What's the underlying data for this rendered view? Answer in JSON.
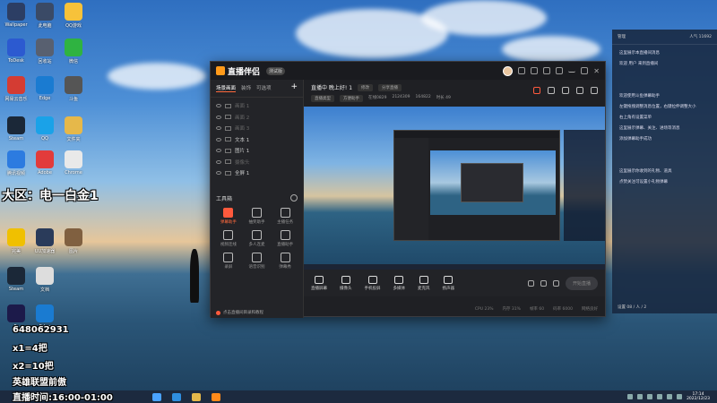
{
  "desktop": {
    "icons": [
      {
        "label": "Wallpaper",
        "color": "#2c3e64"
      },
      {
        "label": "此电脑",
        "color": "#3a4a66"
      },
      {
        "label": "QQ游戏",
        "color": "#f7c23a"
      },
      {
        "label": "ToDesk",
        "color": "#2c5ad0"
      },
      {
        "label": "回收站",
        "color": "#586070"
      },
      {
        "label": "微信",
        "color": "#2fb341"
      },
      {
        "label": "网易云音乐",
        "color": "#d43c33"
      },
      {
        "label": "Edge",
        "color": "#1a7bd1"
      },
      {
        "label": "斗鱼",
        "color": "#555"
      },
      {
        "label": "Steam",
        "color": "#1b2838"
      },
      {
        "label": "QQ",
        "color": "#1aa2e8"
      },
      {
        "label": "文件夹",
        "color": "#e6b84a"
      },
      {
        "label": "腾讯视频",
        "color": "#2c7be0"
      },
      {
        "label": "Adobe",
        "color": "#e23b3b"
      },
      {
        "label": "Chrome",
        "color": "#e9e9e9"
      },
      {
        "label": "完美",
        "color": "#f0c000"
      },
      {
        "label": "UU加速器",
        "color": "#2a3b5a"
      },
      {
        "label": "图片",
        "color": "#806040"
      },
      {
        "label": "Steam",
        "color": "#1b2838"
      },
      {
        "label": "文档",
        "color": "#dddddd"
      },
      {
        "label": "Pr",
        "color": "#1c1a4a"
      },
      {
        "label": "Edge",
        "color": "#1a7bd1"
      }
    ],
    "overlay": {
      "region": "大区：电一白金1",
      "qq": "648062931",
      "rule1": "x1=4把",
      "rule2": "x2=10把",
      "game": "英雄联盟前傲",
      "live_time": "直播时间:16:00-01:00"
    }
  },
  "app": {
    "name": "直播伴侣",
    "version": "测试版",
    "left_tabs": [
      "场景画面",
      "装饰",
      "可选项"
    ],
    "scenes": [
      {
        "label": "画面 1",
        "on": false
      },
      {
        "label": "画面 2",
        "on": false
      },
      {
        "label": "画面 3",
        "on": false
      },
      {
        "label": "文本 1",
        "on": true
      },
      {
        "label": "图片 1",
        "on": true
      },
      {
        "label": "摄像头",
        "on": false
      },
      {
        "label": "全屏 1",
        "on": true
      }
    ],
    "tools_title": "工具箱",
    "tools": [
      {
        "label": "弹幕助手",
        "hot": true
      },
      {
        "label": "抽奖助手",
        "hot": false
      },
      {
        "label": "主播任务",
        "hot": false
      },
      {
        "label": "视频连线",
        "hot": false
      },
      {
        "label": "多人连麦",
        "hot": false
      },
      {
        "label": "直播助手",
        "hot": false
      },
      {
        "label": "录屏",
        "hot": false
      },
      {
        "label": "语音识别",
        "hot": false
      },
      {
        "label": "弹幕秀",
        "hot": false
      }
    ],
    "left_footer": "点击直播间目录和教程",
    "stream": {
      "title": "直播中 晚上好! 1",
      "tag1": "修改",
      "tag2": "分享直播",
      "category": "直播类型",
      "mode": "方便助手",
      "meta1": "在线0829",
      "meta2": "2124309",
      "meta3": "164822",
      "meta4": "时长 49"
    },
    "bottom_tools": [
      "直播屏幕",
      "摄像头",
      "手机投屏",
      "多媒体",
      "麦克风",
      "扬声器"
    ],
    "go_live": "开始直播",
    "status": [
      "CPU 23%",
      "内存 31%",
      "帧率 60",
      "码率 6000",
      "网络良好"
    ]
  },
  "chat": {
    "top_left": "管理",
    "top_right": "人气 11692",
    "messages": [
      "这里展示本直播间消息",
      "欢迎 用户 来到直播间",
      "欢迎使用斗鱼弹幕助手",
      "左键拖拽调整消息位置，右键拉伸调整大小",
      "右上角有设置菜单",
      "这里展示弹幕、关注、进场等消息",
      "添加弹幕助手成功",
      "这里展示你收到的礼物、道具",
      "点赞关注可设置小礼物弹幕"
    ],
    "footer": "设置 08 / 人 / 2"
  },
  "taskbar": {
    "time": "17:14",
    "date": "2022/12/23"
  }
}
